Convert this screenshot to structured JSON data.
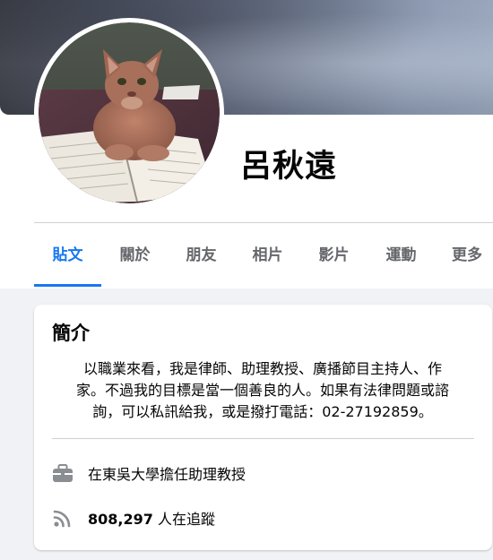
{
  "profile": {
    "name": "呂秋遠"
  },
  "tabs": [
    {
      "label": "貼文",
      "active": true
    },
    {
      "label": "關於",
      "active": false
    },
    {
      "label": "朋友",
      "active": false
    },
    {
      "label": "相片",
      "active": false
    },
    {
      "label": "影片",
      "active": false
    },
    {
      "label": "運動",
      "active": false
    },
    {
      "label": "更多",
      "active": false
    }
  ],
  "intro": {
    "title": "簡介",
    "bio_lines": [
      "以職業來看，我是律師、助理教授、廣播節目主持人、作",
      "家。不過我的目標是當一個善良的人。如果有法律問題或諮",
      "詢，可以私訊給我，或是撥打電話：02-27192859。"
    ],
    "work": {
      "icon": "briefcase-icon",
      "text": "在東吳大學擔任助理教授"
    },
    "followers": {
      "icon": "rss-icon",
      "count": "808,297",
      "text": "人在追蹤"
    }
  },
  "colors": {
    "accent": "#1877f2",
    "tab_text": "#65676b",
    "text": "#050505",
    "feed_bg": "#f0f2f5",
    "divider": "#ced0d4"
  }
}
